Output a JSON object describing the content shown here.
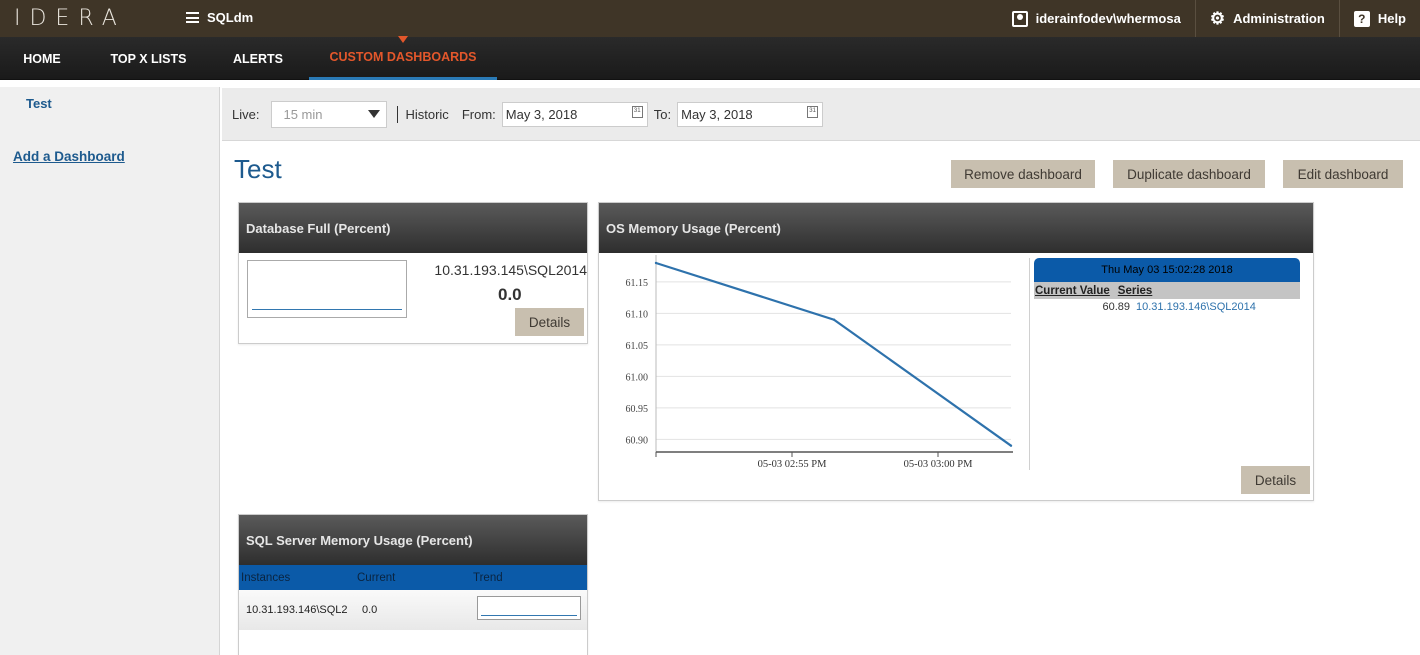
{
  "header": {
    "logo": "IDERA",
    "app_name": "SQLdm",
    "user": "iderainfodev\\whermosa",
    "admin_label": "Administration",
    "help_label": "Help"
  },
  "nav": {
    "tabs": [
      {
        "label": "HOME"
      },
      {
        "label": "TOP X LISTS"
      },
      {
        "label": "ALERTS"
      },
      {
        "label": "CUSTOM DASHBOARDS",
        "active": true
      }
    ]
  },
  "sidebar": {
    "dashboards": [
      "Test"
    ],
    "add_label": "Add a Dashboard"
  },
  "filters": {
    "live_label": "Live:",
    "live_value": "15 min",
    "historic_label": "Historic",
    "from_label": "From:",
    "from_value": "May 3, 2018",
    "to_label": "To:",
    "to_value": "May 3, 2018",
    "calendar_glyph": "31"
  },
  "dashboard": {
    "title": "Test",
    "remove_label": "Remove dashboard",
    "duplicate_label": "Duplicate dashboard",
    "edit_label": "Edit dashboard"
  },
  "widgets": {
    "db_full": {
      "title": "Database Full (Percent)",
      "instance": "10.31.193.145\\SQL2014",
      "value": "0.0",
      "details_label": "Details"
    },
    "os_memory": {
      "title": "OS Memory Usage (Percent)",
      "details_label": "Details",
      "tooltip": {
        "timestamp": "Thu May 03 15:02:28 2018",
        "col_value": "Current Value",
        "col_series": "Series",
        "value": "60.89",
        "series": "10.31.193.146\\SQL2014"
      }
    },
    "sql_memory": {
      "title": "SQL Server Memory Usage (Percent)",
      "columns": [
        "Instances",
        "Current",
        "Trend"
      ],
      "rows": [
        {
          "instance": "10.31.193.146\\SQL2",
          "current": "0.0"
        }
      ]
    }
  },
  "chart_data": {
    "type": "line",
    "series": [
      {
        "x": [
          "05-03 02:51 PM",
          "05-03 02:57 PM",
          "05-03 03:02 PM"
        ],
        "values": [
          61.18,
          61.09,
          60.89
        ]
      }
    ],
    "ytick_labels": [
      "61.15",
      "61.10",
      "61.05",
      "61.00",
      "60.95",
      "60.90"
    ],
    "xtick_labels": [
      "05-03 02:55 PM",
      "05-03 03:00 PM"
    ],
    "ylim": [
      60.88,
      61.18
    ],
    "grid": true,
    "line_color": "#2e72ac"
  }
}
